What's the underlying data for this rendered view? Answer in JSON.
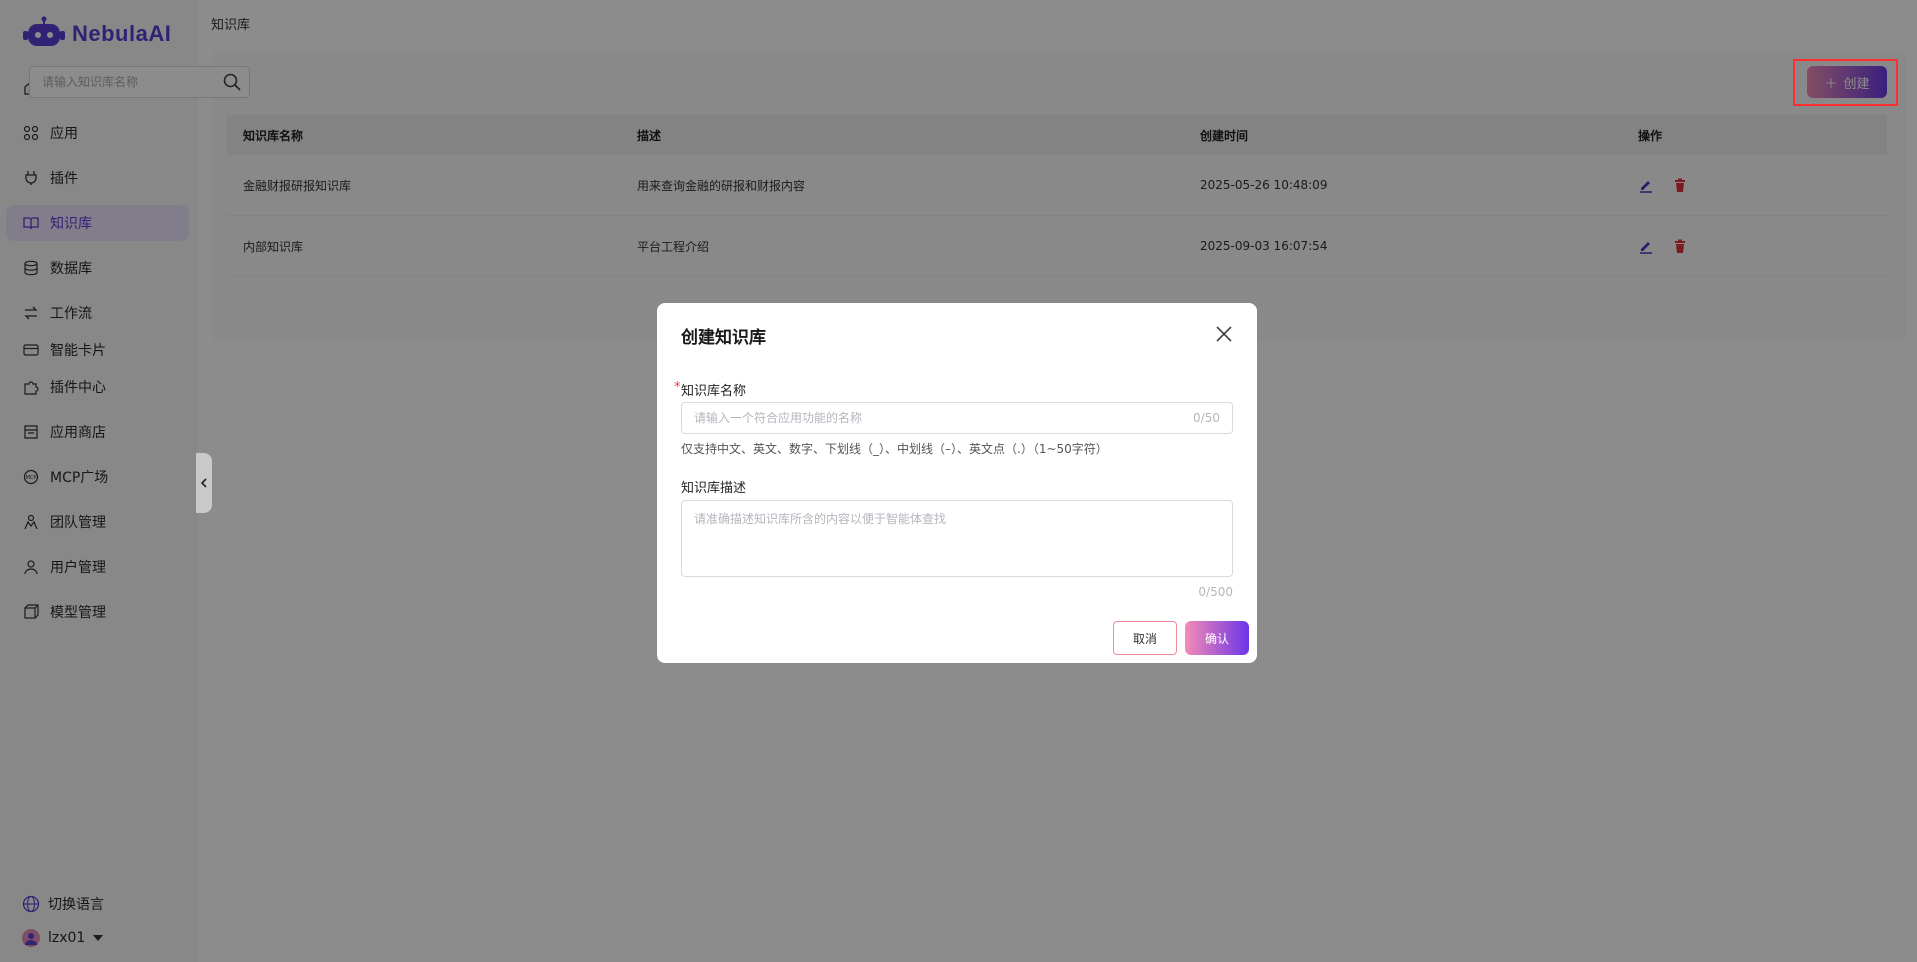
{
  "brand": {
    "name": "NebulaAI"
  },
  "sidebar": {
    "items": [
      {
        "label": "首页",
        "icon": "home-icon"
      },
      {
        "label": "应用",
        "icon": "apps-icon"
      },
      {
        "label": "插件",
        "icon": "plugin-icon"
      },
      {
        "label": "知识库",
        "icon": "book-icon",
        "active": true
      },
      {
        "label": "数据库",
        "icon": "database-icon"
      },
      {
        "label": "工作流",
        "icon": "workflow-icon"
      },
      {
        "label": "智能卡片",
        "icon": "card-icon"
      },
      {
        "label": "插件中心",
        "icon": "puzzle-icon"
      },
      {
        "label": "应用商店",
        "icon": "store-icon"
      },
      {
        "label": "MCP广场",
        "icon": "mcp-icon"
      },
      {
        "label": "团队管理",
        "icon": "team-icon"
      },
      {
        "label": "用户管理",
        "icon": "user-icon"
      },
      {
        "label": "模型管理",
        "icon": "model-icon"
      }
    ],
    "language": "切换语言",
    "username": "lzx01"
  },
  "header": {
    "breadcrumb": "知识库"
  },
  "toolbar": {
    "search_placeholder": "请输入知识库名称",
    "create_label": "创建"
  },
  "table": {
    "columns": [
      "知识库名称",
      "描述",
      "创建时间",
      "操作"
    ],
    "rows": [
      {
        "name": "金融财报研报知识库",
        "desc": "用来查询金融的研报和财报内容",
        "time": "2025-05-26 10:48:09"
      },
      {
        "name": "内部知识库",
        "desc": "平台工程介绍",
        "time": "2025-09-03 16:07:54"
      }
    ]
  },
  "modal": {
    "title": "创建知识库",
    "name_label": "知识库名称",
    "name_placeholder": "请输入一个符合应用功能的名称",
    "name_counter": "0/50",
    "name_hint": "仅支持中文、英文、数字、下划线（_）、中划线（–）、英文点（.）（1~50字符）",
    "desc_label": "知识库描述",
    "desc_placeholder": "请准确描述知识库所含的内容以便于智能体查找",
    "desc_counter": "0/500",
    "cancel_label": "取消",
    "confirm_label": "确认"
  },
  "colors": {
    "accent": "#5b3fd6",
    "danger": "#e0323c",
    "highlight": "#ff2d2d"
  }
}
